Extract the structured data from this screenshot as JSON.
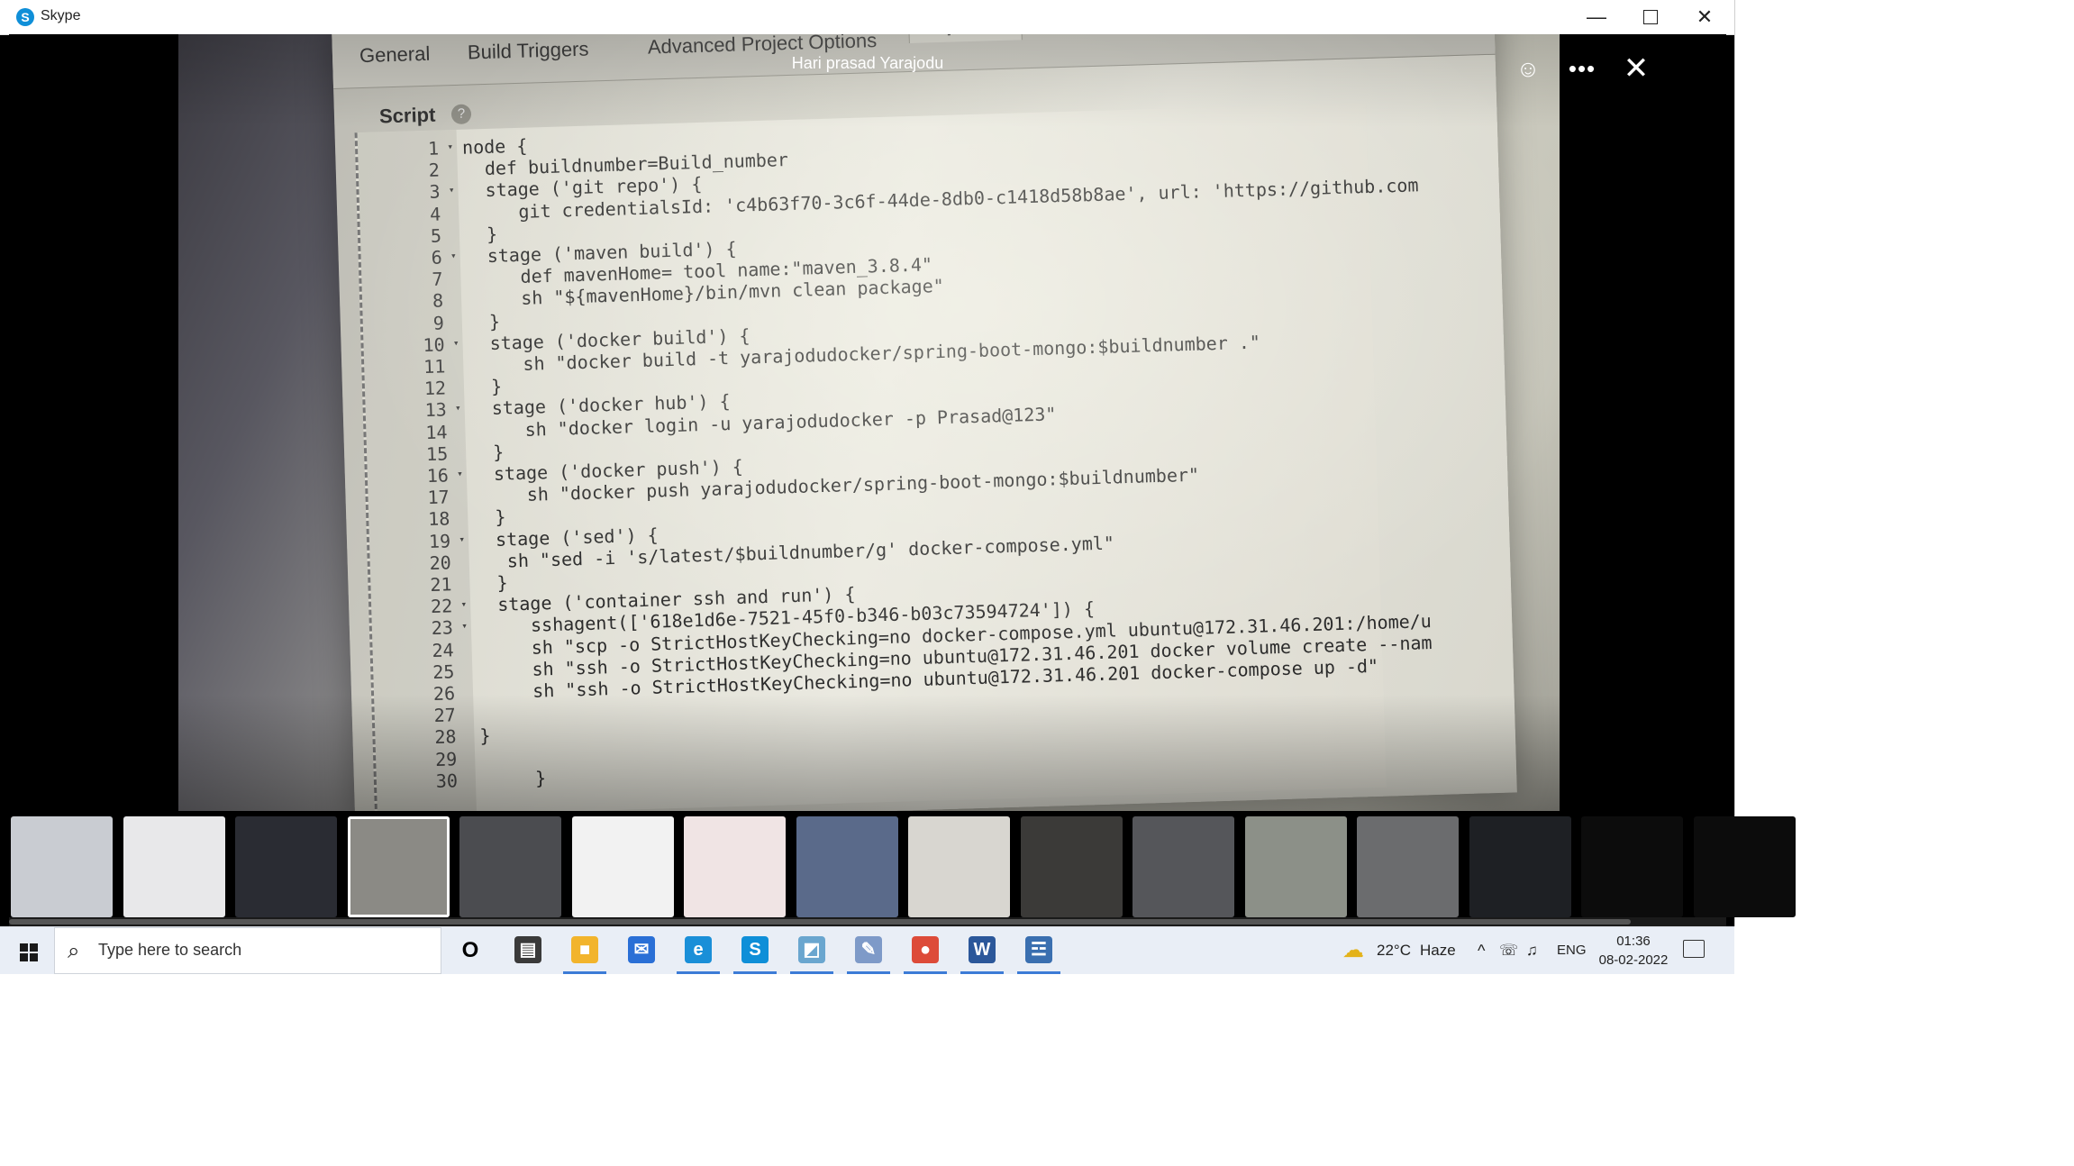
{
  "window": {
    "app_title": "Skype",
    "minimize_glyph": "—",
    "close_glyph": "✕"
  },
  "viewer": {
    "caller_name": "Hari prasad Yarajodu",
    "emoji_glyph": "☺",
    "more_glyph": "•••",
    "close_glyph": "✕"
  },
  "photo": {
    "tabs": [
      "General",
      "Build Triggers",
      "Advanced Project Options",
      "Pipeline"
    ],
    "script_label": "Script",
    "help_glyph": "?",
    "lines": [
      "node {",
      "  def buildnumber=Build_number",
      "  stage ('git repo') {",
      "     git credentialsId: 'c4b63f70-3c6f-44de-8db0-c1418d58b8ae', url: 'https://github.com",
      "  }",
      "  stage ('maven build') {",
      "     def mavenHome= tool name:\"maven_3.8.4\"",
      "     sh \"${mavenHome}/bin/mvn clean package\"",
      "  }",
      "  stage ('docker build') {",
      "     sh \"docker build -t yarajodudocker/spring-boot-mongo:$buildnumber .\"",
      "  }",
      "  stage ('docker hub') {",
      "     sh \"docker login -u yarajodudocker -p Prasad@123\"",
      "  }",
      "  stage ('docker push') {",
      "     sh \"docker push yarajodudocker/spring-boot-mongo:$buildnumber\"",
      "  }",
      "  stage ('sed') {",
      "   sh \"sed -i 's/latest/$buildnumber/g' docker-compose.yml\"",
      "  }",
      "  stage ('container ssh and run') {",
      "     sshagent(['618e1d6e-7521-45f0-b346-b03c73594724']) {",
      "     sh \"scp -o StrictHostKeyChecking=no docker-compose.yml ubuntu@172.31.46.201:/home/u",
      "     sh \"ssh -o StrictHostKeyChecking=no ubuntu@172.31.46.201 docker volume create --nam",
      "     sh \"ssh -o StrictHostKeyChecking=no ubuntu@172.31.46.201 docker-compose up -d\"",
      "",
      "}",
      "",
      "     }",
      "  }"
    ],
    "line_numbers": [
      "1",
      "2",
      "3",
      "4",
      "5",
      "6",
      "7",
      "8",
      "9",
      "10",
      "11",
      "12",
      "13",
      "14",
      "15",
      "16",
      "17",
      "18",
      "19",
      "20",
      "21",
      "22",
      "23",
      "24",
      "25",
      "26",
      "27",
      "28",
      "29",
      "30"
    ],
    "fold_glyph": "▾"
  },
  "thumbnails": [
    {
      "name": "thumb-1",
      "bg": "#c9ccd2"
    },
    {
      "name": "thumb-2",
      "bg": "#e8e8ea"
    },
    {
      "name": "thumb-3",
      "bg": "#2a2c33"
    },
    {
      "name": "thumb-4",
      "bg": "#8b8a85"
    },
    {
      "name": "thumb-5",
      "bg": "#4b4c50"
    },
    {
      "name": "thumb-6",
      "bg": "#f2f2f2"
    },
    {
      "name": "thumb-7",
      "bg": "#f0e4e4"
    },
    {
      "name": "thumb-8",
      "bg": "#5a6a8a"
    },
    {
      "name": "thumb-9",
      "bg": "#d8d6d0"
    },
    {
      "name": "thumb-10",
      "bg": "#3b3a38"
    },
    {
      "name": "thumb-11",
      "bg": "#55565a"
    },
    {
      "name": "thumb-12",
      "bg": "#8c9088"
    },
    {
      "name": "thumb-13",
      "bg": "#6b6c6e"
    },
    {
      "name": "thumb-14",
      "bg": "#1e2024"
    },
    {
      "name": "thumb-15",
      "bg": "#0c0c0c"
    },
    {
      "name": "thumb-16",
      "bg": "#0c0c0c"
    }
  ],
  "taskbar": {
    "search_placeholder": "Type here to search",
    "search_glyph": "⌕",
    "task_view_glyph": "O",
    "apps": [
      {
        "name": "widgets",
        "glyph": "▤",
        "color": "#3a3a3a",
        "open": false
      },
      {
        "name": "file-explorer",
        "glyph": "■",
        "color": "#f2b42c",
        "open": true
      },
      {
        "name": "mail",
        "glyph": "✉",
        "color": "#2a6fd6",
        "open": false
      },
      {
        "name": "edge",
        "glyph": "e",
        "color": "#1a8fd8",
        "open": true
      },
      {
        "name": "skype",
        "glyph": "S",
        "color": "#0f8fd8",
        "open": true
      },
      {
        "name": "vmware",
        "glyph": "◩",
        "color": "#6aa6cf",
        "open": true
      },
      {
        "name": "pen-tool",
        "glyph": "✎",
        "color": "#7e9ac8",
        "open": true
      },
      {
        "name": "chrome",
        "glyph": "●",
        "color": "#dd4b39",
        "open": true
      },
      {
        "name": "word",
        "glyph": "W",
        "color": "#2b579a",
        "open": true
      },
      {
        "name": "network-tool",
        "glyph": "☲",
        "color": "#3a6fb0",
        "open": true
      }
    ],
    "weather_glyph": "☁",
    "weather_temp": "22°C",
    "weather_desc": "Haze",
    "chevron_glyph": "^",
    "meet_glyph": "☏",
    "volume_glyph": "♫",
    "language": "ENG",
    "time": "01:36",
    "date": "08-02-2022"
  }
}
